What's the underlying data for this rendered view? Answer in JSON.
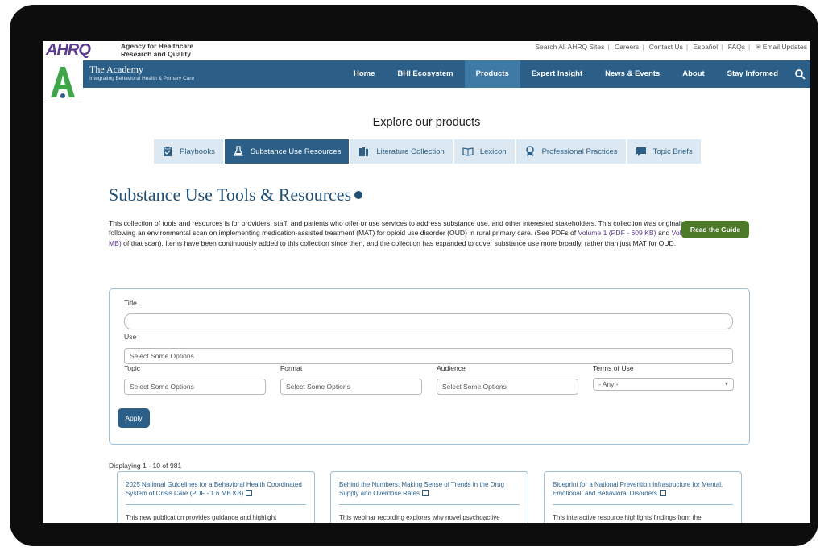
{
  "header": {
    "logo_text": "AHRQ",
    "agency_line1": "Agency for Healthcare",
    "agency_line2": "Research and Quality",
    "util_links": [
      "Search All AHRQ Sites",
      "Careers",
      "Contact Us",
      "Español",
      "FAQs",
      "Email Updates"
    ]
  },
  "nav": {
    "brand_title": "The Academy",
    "brand_subtitle": "Integrating Behavioral Health & Primary Care",
    "items": [
      {
        "label": "Home",
        "active": false
      },
      {
        "label": "BHI Ecosystem",
        "active": false
      },
      {
        "label": "Products",
        "active": true
      },
      {
        "label": "Expert Insight",
        "active": false
      },
      {
        "label": "News & Events",
        "active": false
      },
      {
        "label": "About",
        "active": false
      },
      {
        "label": "Stay Informed",
        "active": false
      }
    ]
  },
  "explore": {
    "title": "Explore our products",
    "tabs": [
      {
        "label": "Playbooks",
        "icon": "clipboard-icon",
        "active": false
      },
      {
        "label": "Substance Use Resources",
        "icon": "flask-icon",
        "active": true
      },
      {
        "label": "Literature Collection",
        "icon": "books-icon",
        "active": false
      },
      {
        "label": "Lexicon",
        "icon": "open-book-icon",
        "active": false
      },
      {
        "label": "Professional Practices",
        "icon": "award-icon",
        "active": false
      },
      {
        "label": "Topic Briefs",
        "icon": "chat-icon",
        "active": false
      }
    ]
  },
  "page": {
    "title": "Substance Use Tools & Resources",
    "description_p1": "This collection of tools and resources is for providers, staff, and patients who offer or use services to address substance use, and other interested stakeholders. This collection was originally established following an environmental scan on implementing medication-assisted treatment (MAT) for opioid use disorder (OUD) in rural primary care. (See PDFs of ",
    "vol1_link": "Volume 1 (PDF - 609 KB)",
    "desc_and": " and ",
    "vol2_link": "Volume 2 (PDF - 1.3 MB)",
    "description_p2": " of that scan). Items have been continuously added to this collection since then, and the collection has expanded to cover substance use more broadly, rather than just MAT for OUD.",
    "guide_button": "Read the Guide"
  },
  "filters": {
    "title_label": "Title",
    "title_value": "",
    "use_label": "Use",
    "use_placeholder": "Select Some Options",
    "topic_label": "Topic",
    "topic_placeholder": "Select Some Options",
    "format_label": "Format",
    "format_placeholder": "Select Some Options",
    "audience_label": "Audience",
    "audience_placeholder": "Select Some Options",
    "terms_label": "Terms of Use",
    "terms_value": "- Any -",
    "apply_label": "Apply"
  },
  "results": {
    "displaying": "Displaying 1 - 10 of 981",
    "cards": [
      {
        "title": "2025 National Guidelines for a Behavioral Health Coordinated System of Crisis Care (PDF - 1.6 MB KB)",
        "body": "This new publication provides guidance and highlight"
      },
      {
        "title": "Behind the Numbers: Making Sense of Trends in the Drug Supply and Overdose Rates",
        "body": "This webinar recording explores why novel psychoactive"
      },
      {
        "title": "Blueprint for a National Prevention Infrastructure for Mental, Emotional, and Behavioral Disorders",
        "body": "This interactive resource highlights findings from the"
      }
    ]
  },
  "colors": {
    "nav_blue": "#2b5f88",
    "nav_active": "#3f7aa6",
    "tab_bg": "#dce9f2",
    "guide_green": "#4c7a26",
    "logo_purple": "#5b3a8c"
  }
}
